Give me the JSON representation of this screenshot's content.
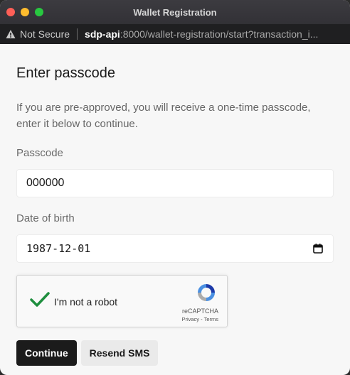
{
  "window": {
    "title": "Wallet Registration"
  },
  "address_bar": {
    "security_label": "Not Secure",
    "host": "sdp-api",
    "path": ":8000/wallet-registration/start?transaction_i..."
  },
  "form": {
    "heading": "Enter passcode",
    "description": "If you are pre-approved, you will receive a one-time passcode, enter it below to continue.",
    "passcode": {
      "label": "Passcode",
      "value": "000000"
    },
    "dob": {
      "label": "Date of birth",
      "value": "1987-12-01"
    },
    "captcha": {
      "label": "I'm not a robot",
      "brand": "reCAPTCHA",
      "links": "Privacy - Terms",
      "checked": true
    },
    "continue_label": "Continue",
    "resend_label": "Resend SMS"
  },
  "colors": {
    "check": "#1e8e3e",
    "primary_button": "#1b1b1b"
  }
}
